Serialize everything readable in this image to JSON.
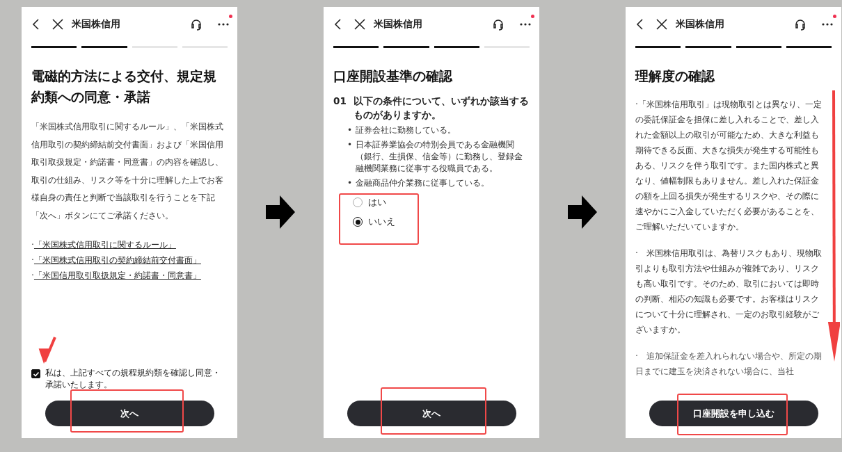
{
  "screens": [
    {
      "kind": "consent",
      "header": {
        "title": "米国株信用",
        "notification": true
      },
      "progress": [
        {
          "done": true
        },
        {
          "done": true
        },
        {
          "done": false
        },
        {
          "done": false
        }
      ],
      "heading": "電磁的方法による交付、規定規約類への同意・承諾",
      "body": "「米国株式信用取引に関するルール」、「米国株式信用取引の契約締結前交付書面」および「米国信用取引取扱規定・約諾書・同意書」の内容を確認し、取引の仕組み、リスク等を十分に理解した上でお客様自身の責任と判断で当該取引を行うことを下記「次へ」ボタンにてご承諾ください。",
      "links": [
        {
          "bullet": "·",
          "label": "「米国株式信用取引に関するルール」"
        },
        {
          "bullet": "·",
          "label": "「米国株式信用取引の契約締結前交付書面」"
        },
        {
          "bullet": "·",
          "label": "「米国信用取引取扱規定・約諾書・同意書」"
        }
      ],
      "agreement": {
        "checked": true,
        "label": "私は、上記すべての規程規約類を確認し同意・承諾いたします。"
      },
      "button": "次へ"
    },
    {
      "kind": "question",
      "header": {
        "title": "米国株信用",
        "notification": true
      },
      "progress": [
        {
          "done": true
        },
        {
          "done": true
        },
        {
          "done": true
        },
        {
          "done": false
        }
      ],
      "heading": "口座開設基準の確認",
      "question": {
        "number": "01",
        "text": "以下の条件について、いずれか該当するものがありますか。",
        "conditions": [
          {
            "bullet": "•",
            "text": "証券会社に勤務している。"
          },
          {
            "bullet": "•",
            "text": "日本証券業協会の特別会員である金融機関（銀行、生損保、信金等）に勤務し、登録金融機関業務に従事する役職員である。"
          },
          {
            "bullet": "•",
            "text": "金融商品仲介業務に従事している。"
          }
        ],
        "options": [
          {
            "label": "はい",
            "selected": false
          },
          {
            "label": "いいえ",
            "selected": true
          }
        ]
      },
      "button": "次へ"
    },
    {
      "kind": "understanding",
      "header": {
        "title": "米国株信用",
        "notification": true
      },
      "progress": [
        {
          "done": true
        },
        {
          "done": true
        },
        {
          "done": true
        },
        {
          "done": true
        }
      ],
      "heading": "理解度の確認",
      "paragraphs": [
        "·「米国株信用取引」は現物取引とは異なり、一定の委託保証金を担保に差し入れることで、差し入れた金額以上の取引が可能なため、大きな利益も期待できる反面、大きな損失が発生する可能性もある、リスクを伴う取引です。また国内株式と異なり、値幅制限もありません。差し入れた保証金の額を上回る損失が発生するリスクや、その際に速やかにご入金していただく必要があることを、ご理解いただいていますか。",
        "·　米国株信用取引は、為替リスクもあり、現物取引よりも取引方法や仕組みが複雑であり、リスクも高い取引です。そのため、取引においては即時の判断、相応の知識も必要です。お客様はリスクについて十分に理解され、一定のお取引経験がございますか。",
        "·　追加保証金を差入れられない場合や、所定の期日までに建玉を決済されない場合に、当社"
      ],
      "button": "口座開設を申し込む"
    }
  ]
}
